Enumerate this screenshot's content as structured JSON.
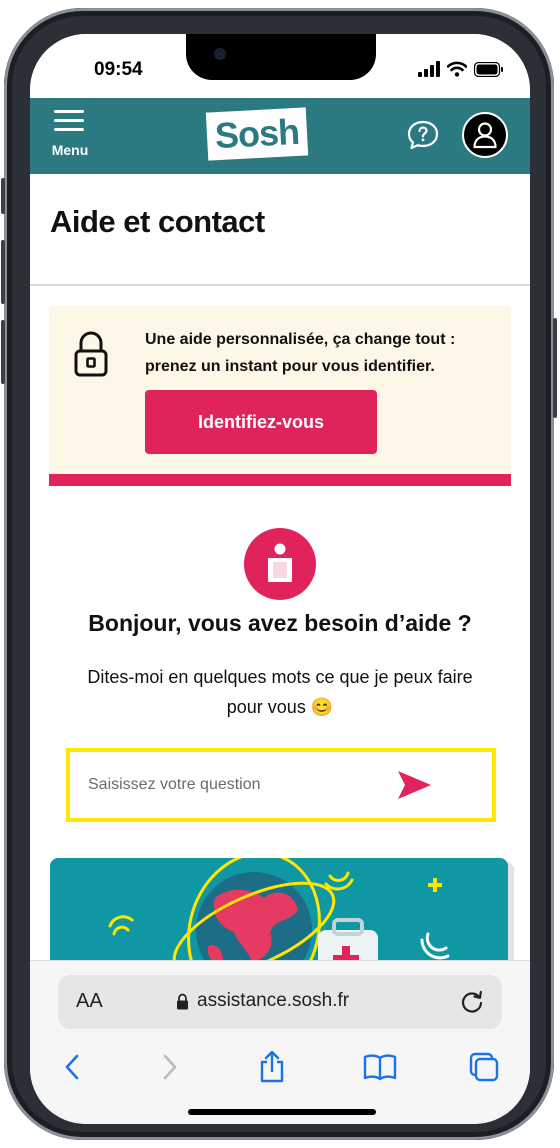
{
  "status_bar": {
    "time": "09:54"
  },
  "header": {
    "menu_label": "Menu",
    "logo_text": "Sosh",
    "help_icon": "chat-question-icon",
    "account_icon": "user-icon",
    "brand_color": "#2b7a82",
    "accent_color": "#e0245b"
  },
  "page": {
    "title": "Aide et contact"
  },
  "login_banner": {
    "message": "Une aide personnalisée, ça change tout : prenez un instant pour vous identifier.",
    "button_label": "Identifiez-vous",
    "icon": "lock-icon"
  },
  "assistant": {
    "icon": "info-icon",
    "greeting": "Bonjour, vous avez besoin d’aide ?",
    "intro": "Dites-moi en quelques mots  ce que je peux faire pour vous 😊",
    "input_placeholder": "Saisissez votre question",
    "input_value": "",
    "send_icon": "send-icon"
  },
  "browser": {
    "text_size_label": "AA",
    "url": "assistance.sosh.fr",
    "nav_icons": [
      "back-icon",
      "forward-icon",
      "share-icon",
      "bookmarks-icon",
      "tabs-icon"
    ]
  }
}
